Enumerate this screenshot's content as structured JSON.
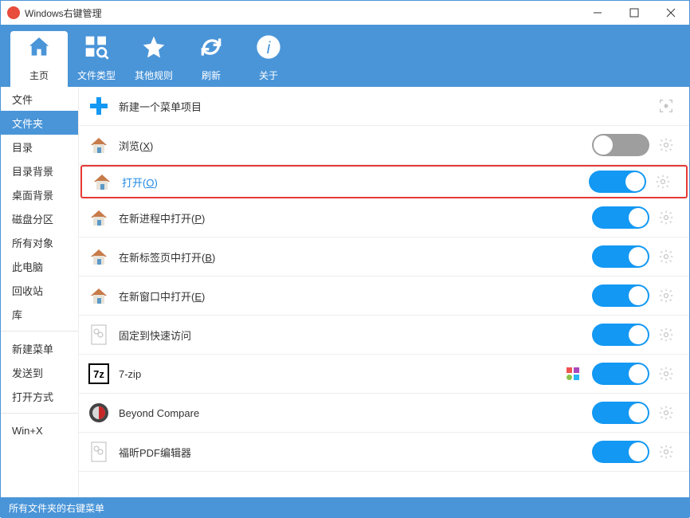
{
  "window": {
    "title": "Windows右键管理"
  },
  "toolbar": {
    "items": [
      {
        "id": "home",
        "label": "主页"
      },
      {
        "id": "filetype",
        "label": "文件类型"
      },
      {
        "id": "rules",
        "label": "其他规则"
      },
      {
        "id": "refresh",
        "label": "刷新"
      },
      {
        "id": "about",
        "label": "关于"
      }
    ],
    "active": 0
  },
  "sidebar": {
    "groups": [
      [
        "文件",
        "文件夹",
        "目录",
        "目录背景",
        "桌面背景",
        "磁盘分区",
        "所有对象",
        "此电脑",
        "回收站",
        "库"
      ],
      [
        "新建菜单",
        "发送到",
        "打开方式"
      ],
      [
        "Win+X"
      ]
    ],
    "active": "文件夹"
  },
  "rows": [
    {
      "icon": "plus",
      "label": "新建一个菜单项目",
      "toggle": null,
      "action": "target"
    },
    {
      "icon": "house",
      "label": "浏览",
      "accel": "X",
      "toggle": false,
      "action": "gear"
    },
    {
      "icon": "house",
      "label": "打开",
      "accel": "O",
      "toggle": true,
      "action": "gear",
      "highlight": true
    },
    {
      "icon": "house",
      "label": "在新进程中打开",
      "accel": "P",
      "toggle": true,
      "action": "gear"
    },
    {
      "icon": "house",
      "label": "在新标签页中打开",
      "accel": "B",
      "toggle": true,
      "action": "gear"
    },
    {
      "icon": "house",
      "label": "在新窗口中打开",
      "accel": "E",
      "toggle": true,
      "action": "gear"
    },
    {
      "icon": "page",
      "label": "固定到快速访问",
      "toggle": true,
      "action": "gear"
    },
    {
      "icon": "7z",
      "label": "7-zip",
      "toggle": true,
      "action": "gear",
      "extra": "shapes"
    },
    {
      "icon": "bc",
      "label": "Beyond Compare",
      "toggle": true,
      "action": "gear"
    },
    {
      "icon": "page",
      "label": "福昕PDF编辑器",
      "toggle": true,
      "action": "gear"
    }
  ],
  "status": {
    "text": "所有文件夹的右键菜单"
  }
}
